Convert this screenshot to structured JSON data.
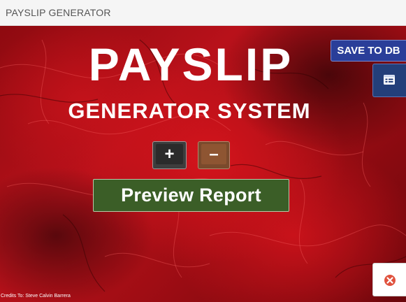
{
  "window": {
    "title": "PAYSLIP GENERATOR"
  },
  "hero": {
    "line1": "PAYSLIP",
    "line2": "GENERATOR SYSTEM"
  },
  "actions": {
    "save_label": "SAVE TO DB",
    "form_icon": "form-icon",
    "add_symbol": "+",
    "remove_symbol": "–",
    "preview_label": "Preview Report",
    "close_icon": "close-icon"
  },
  "footer": {
    "credits": "Credits To: Steve Calvin Barrera"
  },
  "colors": {
    "background": "#b8111a",
    "save_button": "#2a3e99",
    "form_button": "#233f7a",
    "add_button": "#2b2b2b",
    "remove_button": "#8e5532",
    "preview_button": "#3b5e27",
    "close_icon": "#e0523e"
  }
}
